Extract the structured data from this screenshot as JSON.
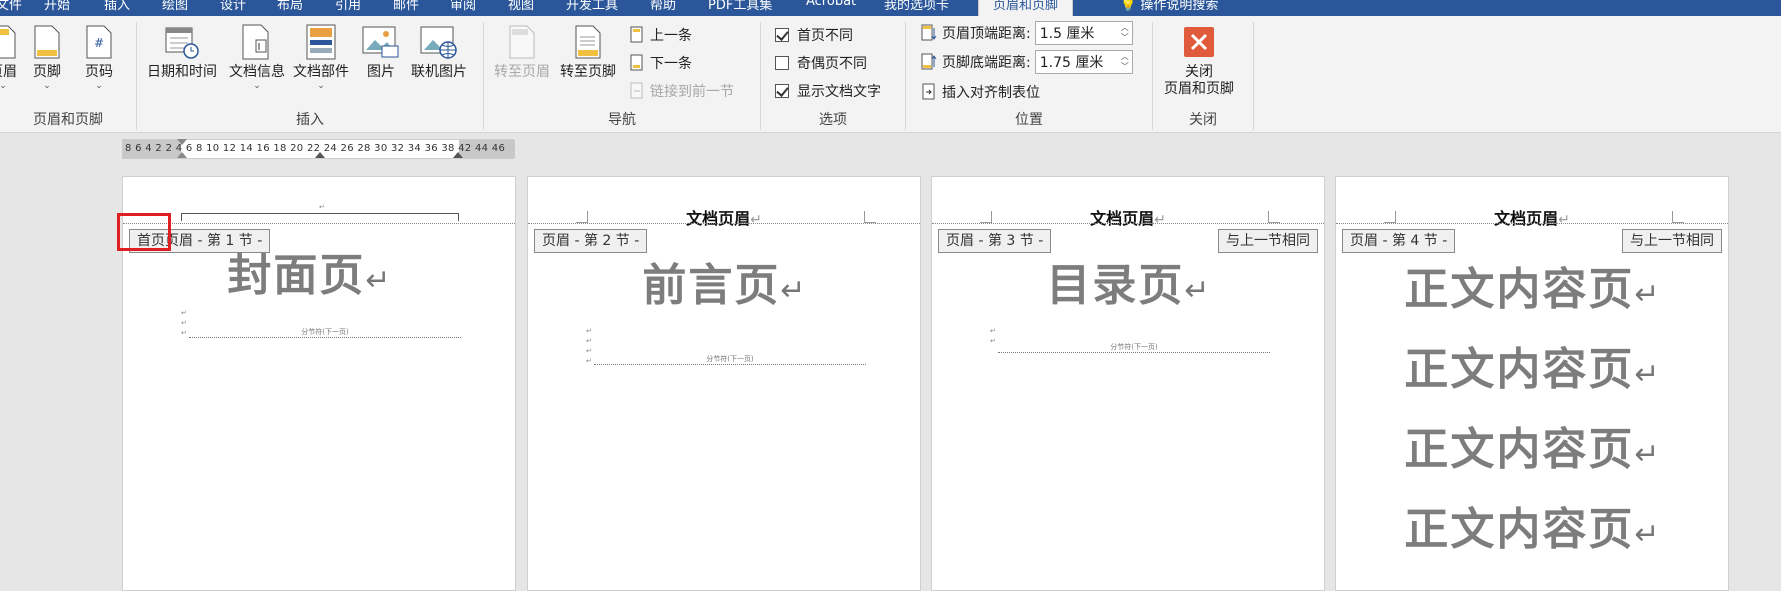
{
  "tabs": [
    {
      "label": "文件"
    },
    {
      "label": "开始"
    },
    {
      "label": "插入"
    },
    {
      "label": "绘图"
    },
    {
      "label": "设计"
    },
    {
      "label": "布局"
    },
    {
      "label": "引用"
    },
    {
      "label": "邮件"
    },
    {
      "label": "审阅"
    },
    {
      "label": "视图"
    },
    {
      "label": "开发工具"
    },
    {
      "label": "帮助"
    },
    {
      "label": "PDF工具集"
    },
    {
      "label": "Acrobat"
    },
    {
      "label": "我的选项卡"
    },
    {
      "label": "页眉和页脚"
    },
    {
      "label": "操作说明搜索"
    }
  ],
  "ribbon": {
    "hf_group": {
      "label": "页眉和页脚",
      "header_btn": "页眉",
      "footer_btn": "页脚",
      "pagenum_btn": "页码"
    },
    "insert_group": {
      "label": "插入",
      "datetime_btn": "日期和时间",
      "docinfo_btn": "文档信息",
      "docparts_btn": "文档部件",
      "picture_btn": "图片",
      "onlinepic_btn": "联机图片"
    },
    "nav_group": {
      "label": "导航",
      "goto_header_btn": "转至页眉",
      "goto_footer_btn": "转至页脚",
      "prev_btn": "上一条",
      "next_btn": "下一条",
      "link_prev_btn": "链接到前一节"
    },
    "options_group": {
      "label": "选项",
      "first_page_diff": {
        "label": "首页不同",
        "checked": true
      },
      "odd_even_diff": {
        "label": "奇偶页不同",
        "checked": false
      },
      "show_doc_text": {
        "label": "显示文档文字",
        "checked": true
      }
    },
    "position_group": {
      "label": "位置",
      "header_top_label": "页眉顶端距离:",
      "header_top_value": "1.5 厘米",
      "footer_bottom_label": "页脚底端距离:",
      "footer_bottom_value": "1.75 厘米",
      "insert_align_tab": "插入对齐制表位"
    },
    "close_group": {
      "label": "关闭",
      "close_btn_line1": "关闭",
      "close_btn_line2": "页眉和页脚"
    }
  },
  "ruler": {
    "numbers": "8  6  4  2    2  4  6  8 10 12 14 16 18 20 22 24 26 28 30 32 34 36 38   42 44 46"
  },
  "pages": [
    {
      "header_text": "",
      "section_tag": "首页页眉 - 第 1 节 -",
      "same_as_prev": "",
      "title": "封面页",
      "break_text": "分节符(下一页)"
    },
    {
      "header_text": "文档页眉",
      "section_tag": "页眉 - 第 2 节 -",
      "same_as_prev": "",
      "title": "前言页",
      "break_text": "分节符(下一页)"
    },
    {
      "header_text": "文档页眉",
      "section_tag": "页眉 - 第 3 节 -",
      "same_as_prev": "与上一节相同",
      "title": "目录页",
      "break_text": "分节符(下一页)"
    },
    {
      "header_text": "文档页眉",
      "section_tag": "页眉 - 第 4 节 -",
      "same_as_prev": "与上一节相同",
      "body_lines": [
        "正文内容页",
        "正文内容页",
        "正文内容页",
        "正文内容页"
      ]
    }
  ],
  "colors": {
    "accent": "#2b579a",
    "highlight_box": "#e02020",
    "close_button": "#e05a3c"
  }
}
